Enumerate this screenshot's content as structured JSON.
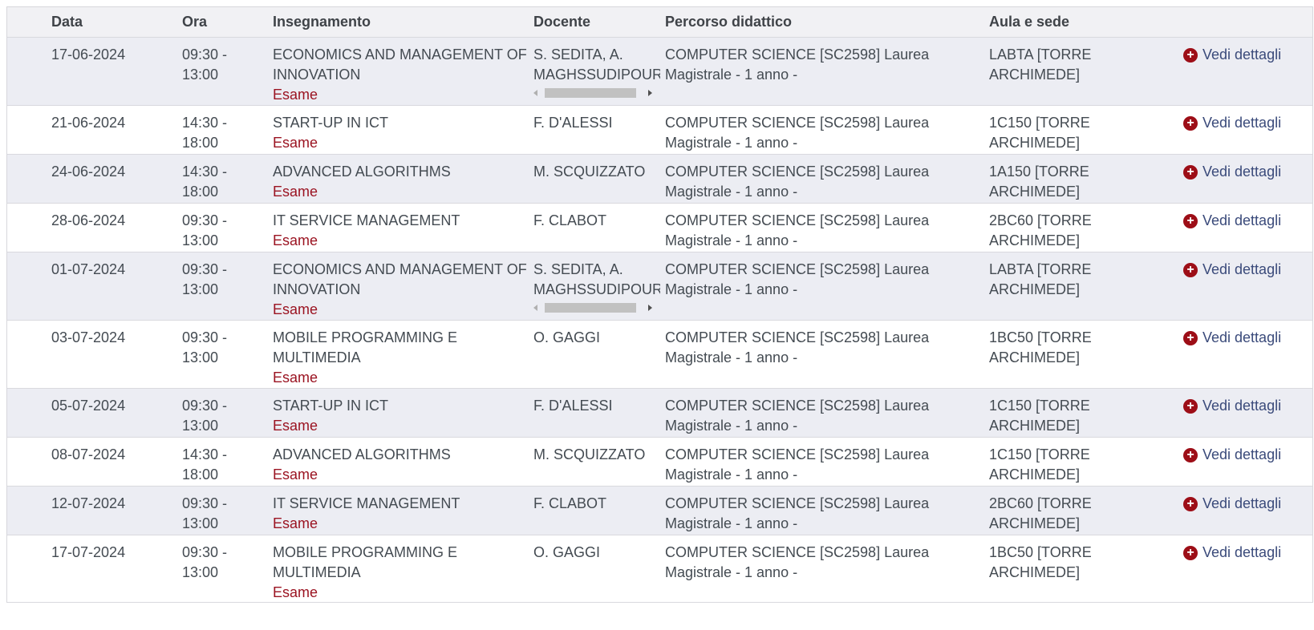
{
  "headers": {
    "data": "Data",
    "ora": "Ora",
    "insegnamento": "Insegnamento",
    "docente": "Docente",
    "percorso": "Percorso didattico",
    "aula": "Aula e sede"
  },
  "action_icon": "plus-circle-icon",
  "colors": {
    "accent": "#9d0e17",
    "link": "#3a4a7a",
    "row_alt": "#ecedf3"
  },
  "rows": [
    {
      "data": "17-06-2024",
      "ora": "09:30 - 13:00",
      "insegnamento": "ECONOMICS AND MANAGEMENT OF INNOVATION",
      "tipo": "Esame",
      "docente": "S. SEDITA, A. MAGHSSUDIPOUR",
      "percorso": "COMPUTER SCIENCE [SC2598] Laurea Magistrale - 1 anno -",
      "aula": "LABTA [TORRE ARCHIMEDE]",
      "azione": "Vedi dettagli"
    },
    {
      "data": "21-06-2024",
      "ora": "14:30 - 18:00",
      "insegnamento": "START-UP IN ICT",
      "tipo": "Esame",
      "docente": "F. D'ALESSI",
      "percorso": "COMPUTER SCIENCE [SC2598] Laurea Magistrale - 1 anno -",
      "aula": "1C150 [TORRE ARCHIMEDE]",
      "azione": "Vedi dettagli"
    },
    {
      "data": "24-06-2024",
      "ora": "14:30 - 18:00",
      "insegnamento": "ADVANCED ALGORITHMS",
      "tipo": "Esame",
      "docente": "M. SCQUIZZATO",
      "percorso": "COMPUTER SCIENCE [SC2598] Laurea Magistrale - 1 anno -",
      "aula": "1A150 [TORRE ARCHIMEDE]",
      "azione": "Vedi dettagli"
    },
    {
      "data": "28-06-2024",
      "ora": "09:30 - 13:00",
      "insegnamento": "IT SERVICE MANAGEMENT",
      "tipo": "Esame",
      "docente": "F. CLABOT",
      "percorso": "COMPUTER SCIENCE [SC2598] Laurea Magistrale - 1 anno -",
      "aula": "2BC60 [TORRE ARCHIMEDE]",
      "azione": "Vedi dettagli"
    },
    {
      "data": "01-07-2024",
      "ora": "09:30 - 13:00",
      "insegnamento": "ECONOMICS AND MANAGEMENT OF INNOVATION",
      "tipo": "Esame",
      "docente": "S. SEDITA, A. MAGHSSUDIPOUR",
      "percorso": "COMPUTER SCIENCE [SC2598] Laurea Magistrale - 1 anno -",
      "aula": "LABTA [TORRE ARCHIMEDE]",
      "azione": "Vedi dettagli"
    },
    {
      "data": "03-07-2024",
      "ora": "09:30 - 13:00",
      "insegnamento": "MOBILE PROGRAMMING E MULTIMEDIA",
      "tipo": "Esame",
      "docente": "O. GAGGI",
      "percorso": "COMPUTER SCIENCE [SC2598] Laurea Magistrale - 1 anno -",
      "aula": "1BC50 [TORRE ARCHIMEDE]",
      "azione": "Vedi dettagli"
    },
    {
      "data": "05-07-2024",
      "ora": "09:30 - 13:00",
      "insegnamento": "START-UP IN ICT",
      "tipo": "Esame",
      "docente": "F. D'ALESSI",
      "percorso": "COMPUTER SCIENCE [SC2598] Laurea Magistrale - 1 anno -",
      "aula": "1C150 [TORRE ARCHIMEDE]",
      "azione": "Vedi dettagli"
    },
    {
      "data": "08-07-2024",
      "ora": "14:30 - 18:00",
      "insegnamento": "ADVANCED ALGORITHMS",
      "tipo": "Esame",
      "docente": "M. SCQUIZZATO",
      "percorso": "COMPUTER SCIENCE [SC2598] Laurea Magistrale - 1 anno -",
      "aula": "1C150 [TORRE ARCHIMEDE]",
      "azione": "Vedi dettagli"
    },
    {
      "data": "12-07-2024",
      "ora": "09:30 - 13:00",
      "insegnamento": "IT SERVICE MANAGEMENT",
      "tipo": "Esame",
      "docente": "F. CLABOT",
      "percorso": "COMPUTER SCIENCE [SC2598] Laurea Magistrale - 1 anno -",
      "aula": "2BC60 [TORRE ARCHIMEDE]",
      "azione": "Vedi dettagli"
    },
    {
      "data": "17-07-2024",
      "ora": "09:30 - 13:00",
      "insegnamento": "MOBILE PROGRAMMING E MULTIMEDIA",
      "tipo": "Esame",
      "docente": "O. GAGGI",
      "percorso": "COMPUTER SCIENCE [SC2598] Laurea Magistrale - 1 anno -",
      "aula": "1BC50 [TORRE ARCHIMEDE]",
      "azione": "Vedi dettagli"
    }
  ]
}
